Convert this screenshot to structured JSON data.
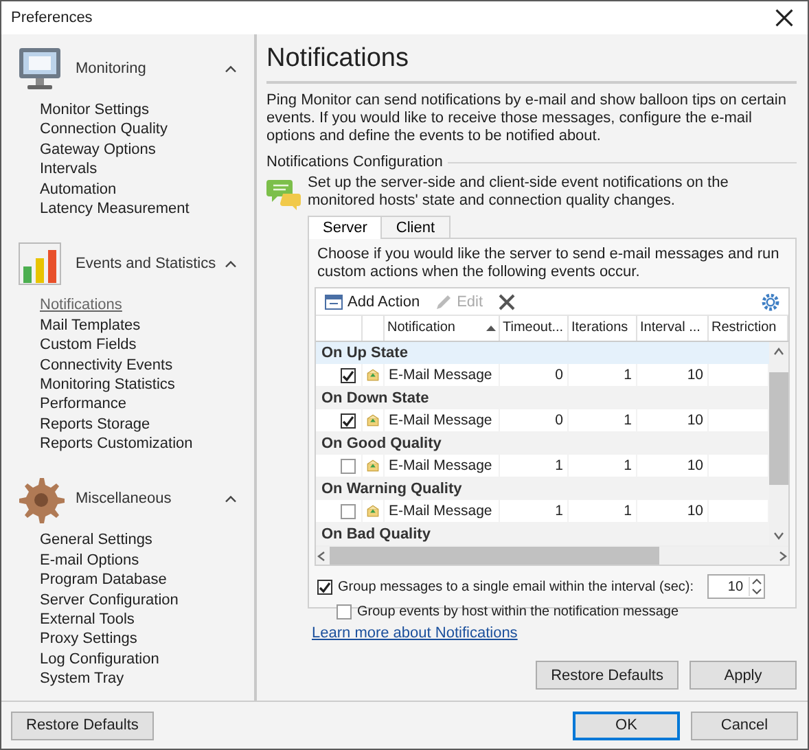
{
  "window": {
    "title": "Preferences"
  },
  "sidebar": {
    "groups": [
      {
        "title": "Monitoring",
        "kind": "monitor",
        "expanded": true,
        "items": [
          {
            "label": "Monitor Settings",
            "selected": false
          },
          {
            "label": "Connection Quality",
            "selected": false
          },
          {
            "label": "Gateway Options",
            "selected": false
          },
          {
            "label": "Intervals",
            "selected": false
          },
          {
            "label": "Automation",
            "selected": false
          },
          {
            "label": "Latency Measurement",
            "selected": false
          }
        ]
      },
      {
        "title": "Events and Statistics",
        "kind": "chart",
        "expanded": true,
        "items": [
          {
            "label": "Notifications",
            "selected": true
          },
          {
            "label": "Mail Templates",
            "selected": false
          },
          {
            "label": "Custom Fields",
            "selected": false
          },
          {
            "label": "Connectivity Events",
            "selected": false
          },
          {
            "label": "Monitoring Statistics",
            "selected": false
          },
          {
            "label": "Performance",
            "selected": false
          },
          {
            "label": "Reports Storage",
            "selected": false
          },
          {
            "label": "Reports Customization",
            "selected": false
          }
        ]
      },
      {
        "title": "Miscellaneous",
        "kind": "gear",
        "expanded": true,
        "items": [
          {
            "label": "General Settings",
            "selected": false
          },
          {
            "label": "E-mail Options",
            "selected": false
          },
          {
            "label": "Program Database",
            "selected": false
          },
          {
            "label": "Server Configuration",
            "selected": false
          },
          {
            "label": "External Tools",
            "selected": false
          },
          {
            "label": "Proxy Settings",
            "selected": false
          },
          {
            "label": "Log Configuration",
            "selected": false
          },
          {
            "label": "System Tray",
            "selected": false
          }
        ]
      }
    ],
    "button": "Restore Defaults"
  },
  "page": {
    "heading": "Notifications",
    "intro": "Ping Monitor can send notifications by e-mail and show balloon tips on certain events. If you would like to receive those messages, configure the e-mail options and define the events to be notified about.",
    "section_title": "Notifications Configuration",
    "section_text": "Set up the server-side and client-side event notifications on the monitored hosts' state and connection quality changes.",
    "tabs": [
      {
        "label": "Server",
        "selected": true
      },
      {
        "label": "Client",
        "selected": false
      }
    ],
    "panel_text": "Choose if you would like the server to send e-mail messages and run custom actions when the following events occur.",
    "toolbar": [
      {
        "kind": "add",
        "label": "Add Action",
        "disabled": false
      },
      {
        "kind": "edit",
        "label": "Edit",
        "disabled": true
      },
      {
        "kind": "delete"
      },
      {
        "kind": "settings"
      }
    ],
    "columns": [
      {
        "label": "Notification",
        "sorted": true
      },
      {
        "label": "Timeout...",
        "sorted": false
      },
      {
        "label": "Iterations",
        "sorted": false
      },
      {
        "label": "Interval ...",
        "sorted": false
      },
      {
        "label": "Restriction",
        "sorted": false
      }
    ],
    "groups": [
      {
        "title": "On Up State",
        "selected": true,
        "actions": [
          {
            "checked": true,
            "name": "E-Mail Message",
            "timeout": "0",
            "iterations": "1",
            "interval": "10"
          }
        ]
      },
      {
        "title": "On Down State",
        "selected": false,
        "actions": [
          {
            "checked": true,
            "name": "E-Mail Message",
            "timeout": "0",
            "iterations": "1",
            "interval": "10"
          }
        ]
      },
      {
        "title": "On Good Quality",
        "selected": false,
        "actions": [
          {
            "checked": false,
            "name": "E-Mail Message",
            "timeout": "1",
            "iterations": "1",
            "interval": "10"
          }
        ]
      },
      {
        "title": "On Warning Quality",
        "selected": false,
        "actions": [
          {
            "checked": false,
            "name": "E-Mail Message",
            "timeout": "1",
            "iterations": "1",
            "interval": "10"
          }
        ]
      },
      {
        "title": "On Bad Quality",
        "selected": false
      }
    ],
    "options": [
      {
        "kind": "spin",
        "label": "Group messages to a single email within the interval (sec):",
        "checked": true,
        "value": "10"
      },
      {
        "kind": "check",
        "label": "Group events by host within the notification message",
        "checked": false
      }
    ],
    "link": "Learn more about Notifications",
    "buttons": [
      "Restore Defaults",
      "Apply"
    ]
  },
  "dialog_buttons": [
    {
      "label": "OK",
      "default": true
    },
    {
      "label": "Cancel",
      "default": false
    }
  ]
}
